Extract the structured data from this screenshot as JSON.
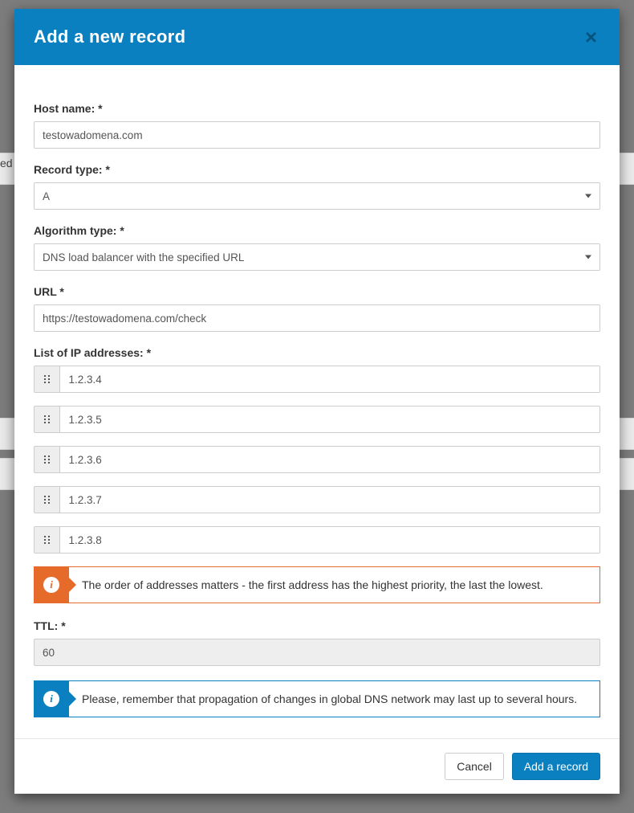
{
  "background": {
    "left_fragment": "ed"
  },
  "modal": {
    "title": "Add a new record",
    "fields": {
      "hostname": {
        "label": "Host name: *",
        "value": "testowadomena.com"
      },
      "record_type": {
        "label": "Record type: *",
        "value": "A"
      },
      "algorithm": {
        "label": "Algorithm type: *",
        "value": "DNS load balancer with the specified URL"
      },
      "url": {
        "label": "URL *",
        "value": "https://testowadomena.com/check"
      },
      "ips": {
        "label": "List of IP addresses: *",
        "values": [
          "1.2.3.4",
          "1.2.3.5",
          "1.2.3.6",
          "1.2.3.7",
          "1.2.3.8"
        ]
      },
      "ttl": {
        "label": "TTL: *",
        "value": "60"
      }
    },
    "notices": {
      "order": "The order of addresses matters - the first address has the highest priority, the last the lowest.",
      "propagation": "Please, remember that propagation of changes in global DNS network may last up to several hours."
    },
    "buttons": {
      "cancel": "Cancel",
      "submit": "Add a record"
    }
  }
}
